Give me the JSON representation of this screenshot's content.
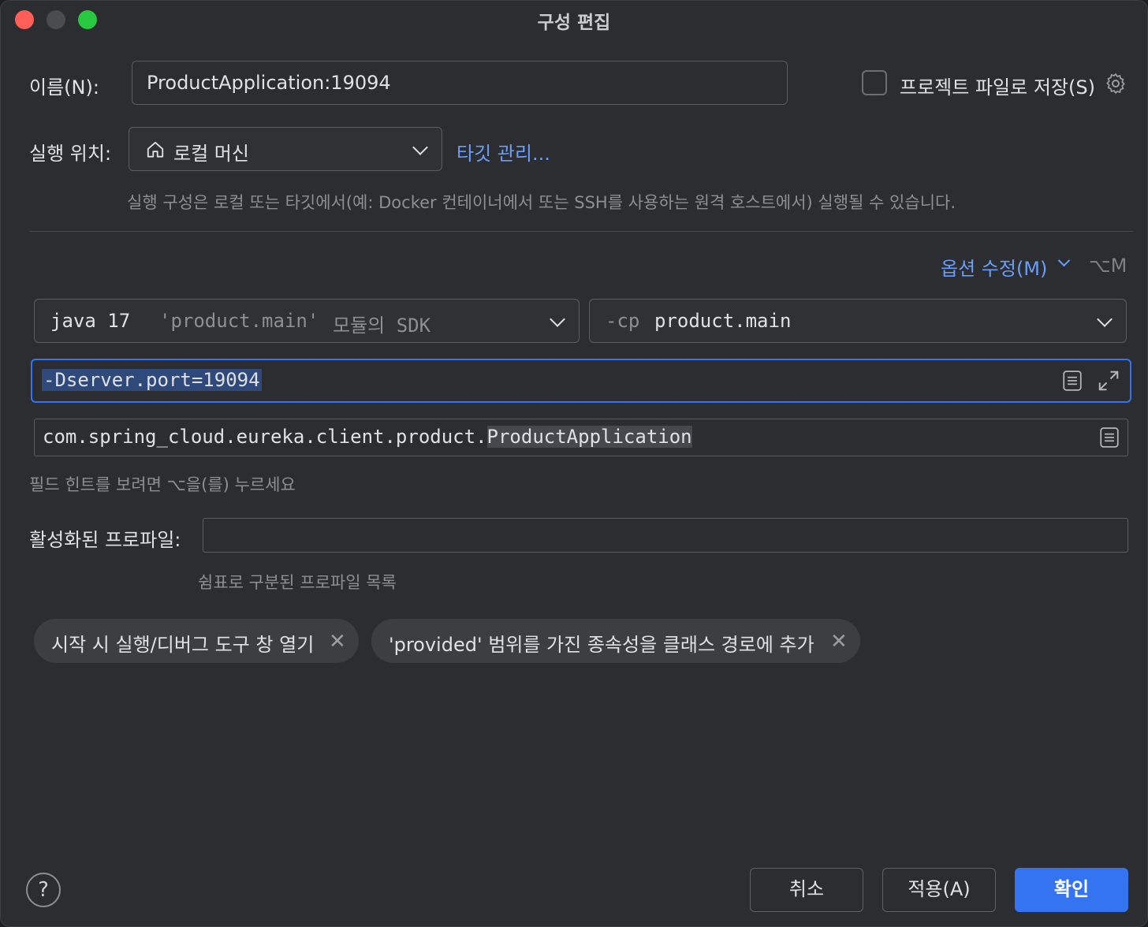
{
  "window": {
    "title": "구성 편집"
  },
  "name": {
    "label": "이름(N):",
    "value": "ProductApplication:19094"
  },
  "store_project": {
    "label": "프로젝트 파일로 저장(S)",
    "checked": false
  },
  "run_on": {
    "label": "실행 위치:",
    "value": "로컬 머신",
    "manage_targets": "타깃 관리...",
    "hint": "실행 구성은 로컬 또는 타깃에서(예: Docker 컨테이너에서 또는 SSH를 사용하는 원격 호스트에서) 실행될 수 있습니다."
  },
  "modify_options": {
    "label": "옵션 수정(M)",
    "shortcut": "⌥M"
  },
  "jdk": {
    "java": "java 17",
    "module": "'product.main'",
    "suffix": "모듈의 SDK"
  },
  "classpath": {
    "flag": "-cp",
    "value": "product.main"
  },
  "vm_options": {
    "value": "-Dserver.port=19094"
  },
  "main_class": {
    "prefix": "com.spring_cloud.eureka.client.product.",
    "name": "ProductApplication"
  },
  "field_hint": "필드 힌트를 보려면 ⌥을(를) 누르세요",
  "profiles": {
    "label": "활성화된 프로파일:",
    "value": "",
    "hint": "쉼표로 구분된 프로파일 목록"
  },
  "chips": [
    {
      "label": "시작 시 실행/디버그 도구 창 열기"
    },
    {
      "label": "'provided' 범위를 가진 종속성을 클래스 경로에 추가"
    }
  ],
  "buttons": {
    "help": "?",
    "cancel": "취소",
    "apply": "적용(A)",
    "ok": "확인"
  },
  "colors": {
    "accent": "#3574f0",
    "link": "#6c9ef8",
    "background": "#2b2d30"
  }
}
